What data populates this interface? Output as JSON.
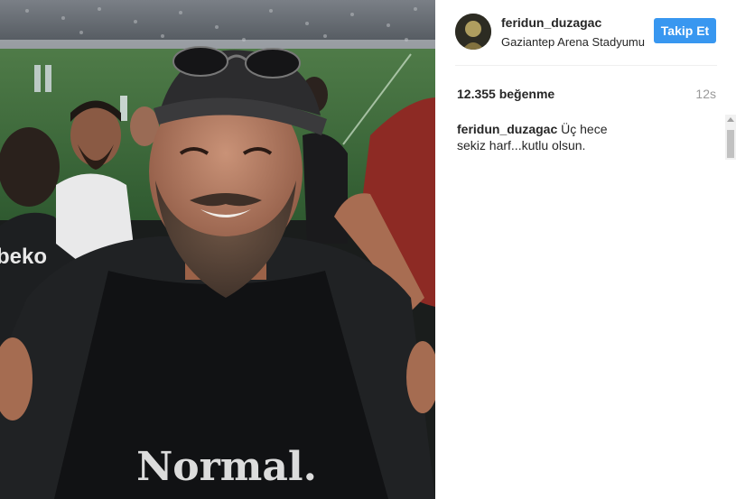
{
  "post": {
    "username": "feridun_duzagac",
    "location": "Gaziantep Arena Stadyumu",
    "follow_label": "Takip Et",
    "likes": "12.355 beğenme",
    "time": "12s",
    "caption_user": "feridun_duzagac",
    "caption_text": "Üç hece sekiz harf...kutlu olsun."
  },
  "photo": {
    "shirt_text": "Normal.",
    "banner_text": "beko"
  },
  "colors": {
    "follow_button": "#3897f0",
    "pitch": "#3e6a3c",
    "text": "#262626",
    "muted": "#999999"
  },
  "icons": [
    "avatar-icon"
  ]
}
